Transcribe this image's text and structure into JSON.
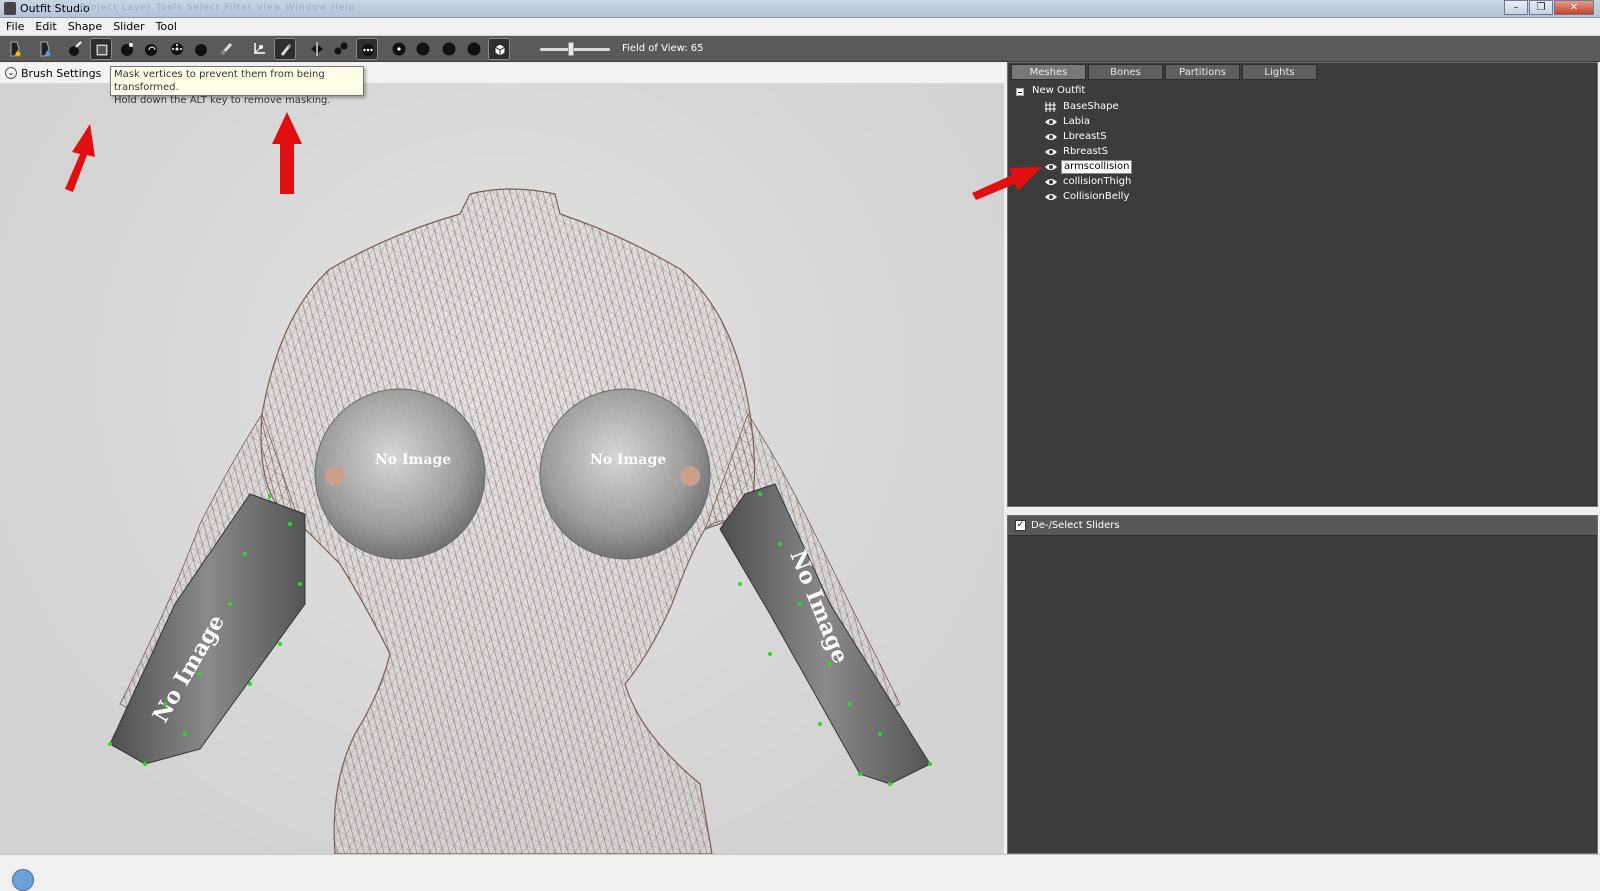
{
  "window": {
    "title": "Outfit Studio",
    "ghost_menu": "Project   Layer   Tools   Select   Filter   View   Window   Help"
  },
  "menu": [
    "File",
    "Edit",
    "Shape",
    "Slider",
    "Tool"
  ],
  "toolbar": {
    "fov_label": "Field of View: 65",
    "fov_fraction": 0.45
  },
  "viewport": {
    "brush_settings_label": "Brush Settings",
    "tooltip_line1": "Mask vertices to prevent them from being transformed.",
    "tooltip_line2": "Hold down the ALT key to remove masking.",
    "placeholder_texture_text": "No Image"
  },
  "mesh_panel": {
    "tabs": [
      "Meshes",
      "Bones",
      "Partitions",
      "Lights"
    ],
    "root": "New Outfit",
    "items": [
      "BaseShape",
      "Labia",
      "LbreastS",
      "RbreastS",
      "armscollision",
      "collisionThigh",
      "CollisionBelly"
    ],
    "selected_item": "armscollision"
  },
  "slider_panel": {
    "header_label": "De-/Select Sliders",
    "checked": true
  },
  "colors": {
    "annotation_arrow": "#e01010",
    "mask_vertex": "#22dd22",
    "panel_bg": "#3c3c3c"
  }
}
